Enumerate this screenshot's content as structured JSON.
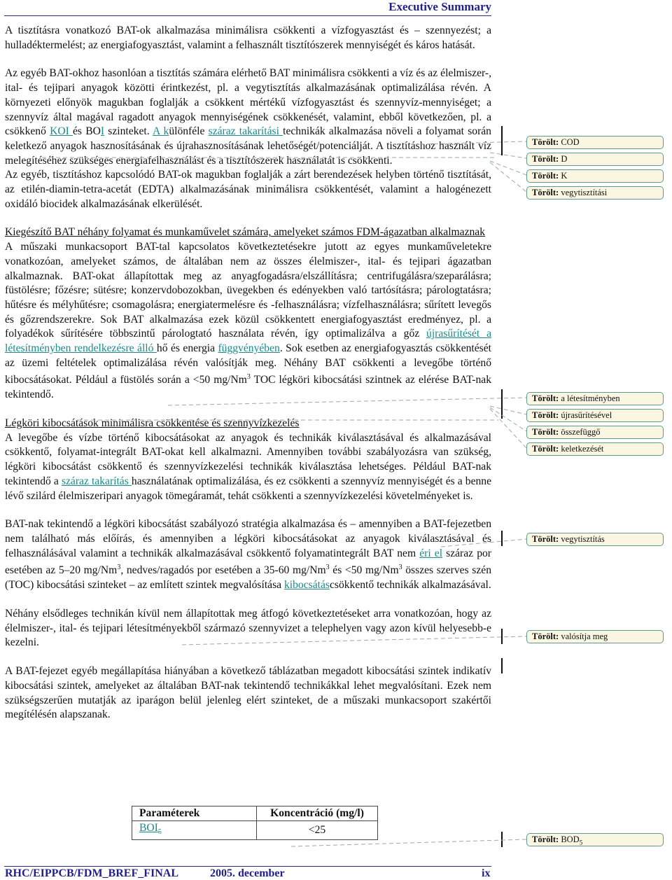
{
  "header": {
    "title": "Executive Summary"
  },
  "paragraphs": {
    "p1": "A tisztításra vonatkozó BAT-ok alkalmazása minimálisra csökkenti a vízfogyasztást és – szennyezést; a hulladéktermelést; az energiafogyasztást, valamint a felhasznált tisztítószerek mennyiségét és káros hatását.",
    "p2a": "Az egyéb BAT-okhoz hasonlóan a tisztítás számára elérhető BAT minimálisra csökkenti a víz és az élelmiszer-, ital- és tejipari anyagok közötti érintkezést, pl. a vegytisztítás alkalmazásának optimalizálása révén. A környezeti előnyök magukban foglalják a csökkent mértékű vízfogyasztást és szennyvíz-mennyiséget; a szennyvíz által magával ragadott anyagok mennyiségének csökkenését, valamint, ebből következően, pl. a csökkenő ",
    "p2_ins1": "KOI ",
    "p2b": "és BO",
    "p2_ins2": "I",
    "p2c": " szinteket. ",
    "p2_ins3": "A k",
    "p2d": "ülönféle ",
    "p2_ins4": "száraz takarítási ",
    "p2e": "technikák alkalmazása növeli a folyamat során keletkező anyagok hasznosításának és újrahasznosításának lehetőségét/potenciálját. A tisztításhoz használt víz melegítéséhez szükséges energiafelhasználást és a tisztítószerek használatát is csökkenti.",
    "p3": "Az egyéb, tisztításhoz kapcsolódó BAT-ok magukban foglalják a zárt berendezések helyben történő tisztítását, az etilén-diamin-tetra-acetát (EDTA) alkalmazásának minimálisra csökkentését, valamint a halogénezett oxidáló biocidek alkalmazásának elkerülését.",
    "h1": "Kiegészítő BAT néhány folyamat és munkaművelet számára, amelyeket számos FDM-ágazatban alkalmaznak",
    "p4a": "A műszaki munkacsoport BAT-tal kapcsolatos következtetésekre jutott az egyes munkaműveletekre vonatkozóan, amelyeket számos, de általában nem az összes élelmiszer-, ital- és tejipari ágazatban alkalmaznak. BAT-okat állapítottak meg az anyagfogadásra/elszállításra; centrifugálásra/szeparálásra; füstölésre; főzésre; sütésre; konzervdobozokban, üvegekben és edényekben való tartósításra; párologtatásra; hűtésre és mélyhűtésre; csomagolásra; energiatermelésre és -felhasználásra; vízfelhasználásra; sűrített levegős és gőzrendszerekre. Sok BAT alkalmazása ezek közül csökkentett energiafogyasztást eredményez, pl. a folyadékok sűrítésére többszintű párologtató használata révén, így optimalizálva a gőz ",
    "p4_ins1": "újrasűrítését a létesítményben rendelkezésre álló ",
    "p4b": "hő és energia ",
    "p4_ins2": "függvényében",
    "p4c": ". Sok esetben az energiafogyasztás csökkentését az üzemi feltételek optimalizálása révén valósítják meg. Néhány BAT csökkenti a levegőbe történő kibocsátásokat. Például a füstölés során a <50 mg/Nm",
    "p4_sup": "3",
    "p4d": " TOC légköri kibocsátási szintnek az elérése BAT-nak tekintendő.",
    "h2": "Légköri kibocsátások minimálisra csökkentése és szennyvízkezelés",
    "p5a": "A levegőbe és vízbe történő kibocsátásokat az anyagok és technikák kiválasztásával és alkalmazásával csökkentő, folyamat-integrált BAT-okat kell alkalmazni. Amennyiben további szabályozásra van szükség, légköri kibocsátást csökkentő és szennyvízkezelési technikák kiválasztása lehetséges. Például BAT-nak tekintendő a ",
    "p5_ins1": "száraz takarítás ",
    "p5b": "használatának optimalizálása, és ez csökkenti a szennyvíz mennyiségét és a benne lévő szilárd élelmiszeripari anyagok tömegáramát, tehát csökkenti a szennyvízkezelési követelményeket is.",
    "p6a": "BAT-nak tekintendő a légköri kibocsátást szabályozó stratégia alkalmazása és – amennyiben a BAT-fejezetben nem található más előírás, és amennyiben a légköri kibocsátásokat az anyagok kiválasztásával és felhasználásával valamint a technikák alkalmazásával csökkentő folyamatintegrált BAT nem ",
    "p6_ins1": "éri el",
    "p6b": " száraz por esetében az 5–20 mg/Nm",
    "p6_sup1": "3",
    "p6c": ", nedves/ragadós por esetében a 35-60 mg/Nm",
    "p6_sup2": "3",
    "p6d": " és <50 mg/Nm",
    "p6_sup3": "3",
    "p6e": " összes szerves szén (TOC) kibocsátási szinteket – az említett szintek megvalósítása ",
    "p6_ins2": "kibocsátás",
    "p6f": "csökkentő technikák alkalmazásával.",
    "p7": "Néhány elsődleges technikán kívül nem állapítottak meg átfogó következtetéseket arra vonatkozóan, hogy az élelmiszer-, ital- és tejipari létesítményekből származó szennyvizet a telephelyen vagy azon kívül helyesebb-e kezelni.",
    "p8": "A BAT-fejezet egyéb megállapítása hiányában a következő táblázatban megadott kibocsátási szintek indikatív kibocsátási szintek, amelyeket az általában BAT-nak tekintendő technikákkal lehet megvalósítani. Ezek nem szükségszerűen mutatják az iparágon belül jelenleg elért szinteket, de a műszaki munkacsoport szakértői megítélésén alapszanak."
  },
  "table": {
    "headers": [
      "Paraméterek",
      "Koncentráció (mg/l)"
    ],
    "rows": [
      {
        "param": "BOI",
        "param_sub": "5",
        "value": "<25"
      }
    ]
  },
  "comments": {
    "label": "Törölt:",
    "items": [
      "COD",
      "D",
      "K",
      "vegytisztítási",
      "a létesítményben",
      "újrasűrítésével",
      "összefüggő",
      "keletkezését",
      "vegytisztítás",
      "valósítja meg",
      "BOD"
    ],
    "last_sub": "5"
  },
  "footer": {
    "doc_id": "RHC/EIPPCB/FDM_BREF_FINAL",
    "date": "2005. december",
    "page": "ix"
  },
  "colors": {
    "heading_blue": "#1f1f8f",
    "insertion_teal": "#1a8a8a",
    "comment_bg": "#fbf6e2",
    "comment_border": "#5b9a92"
  }
}
